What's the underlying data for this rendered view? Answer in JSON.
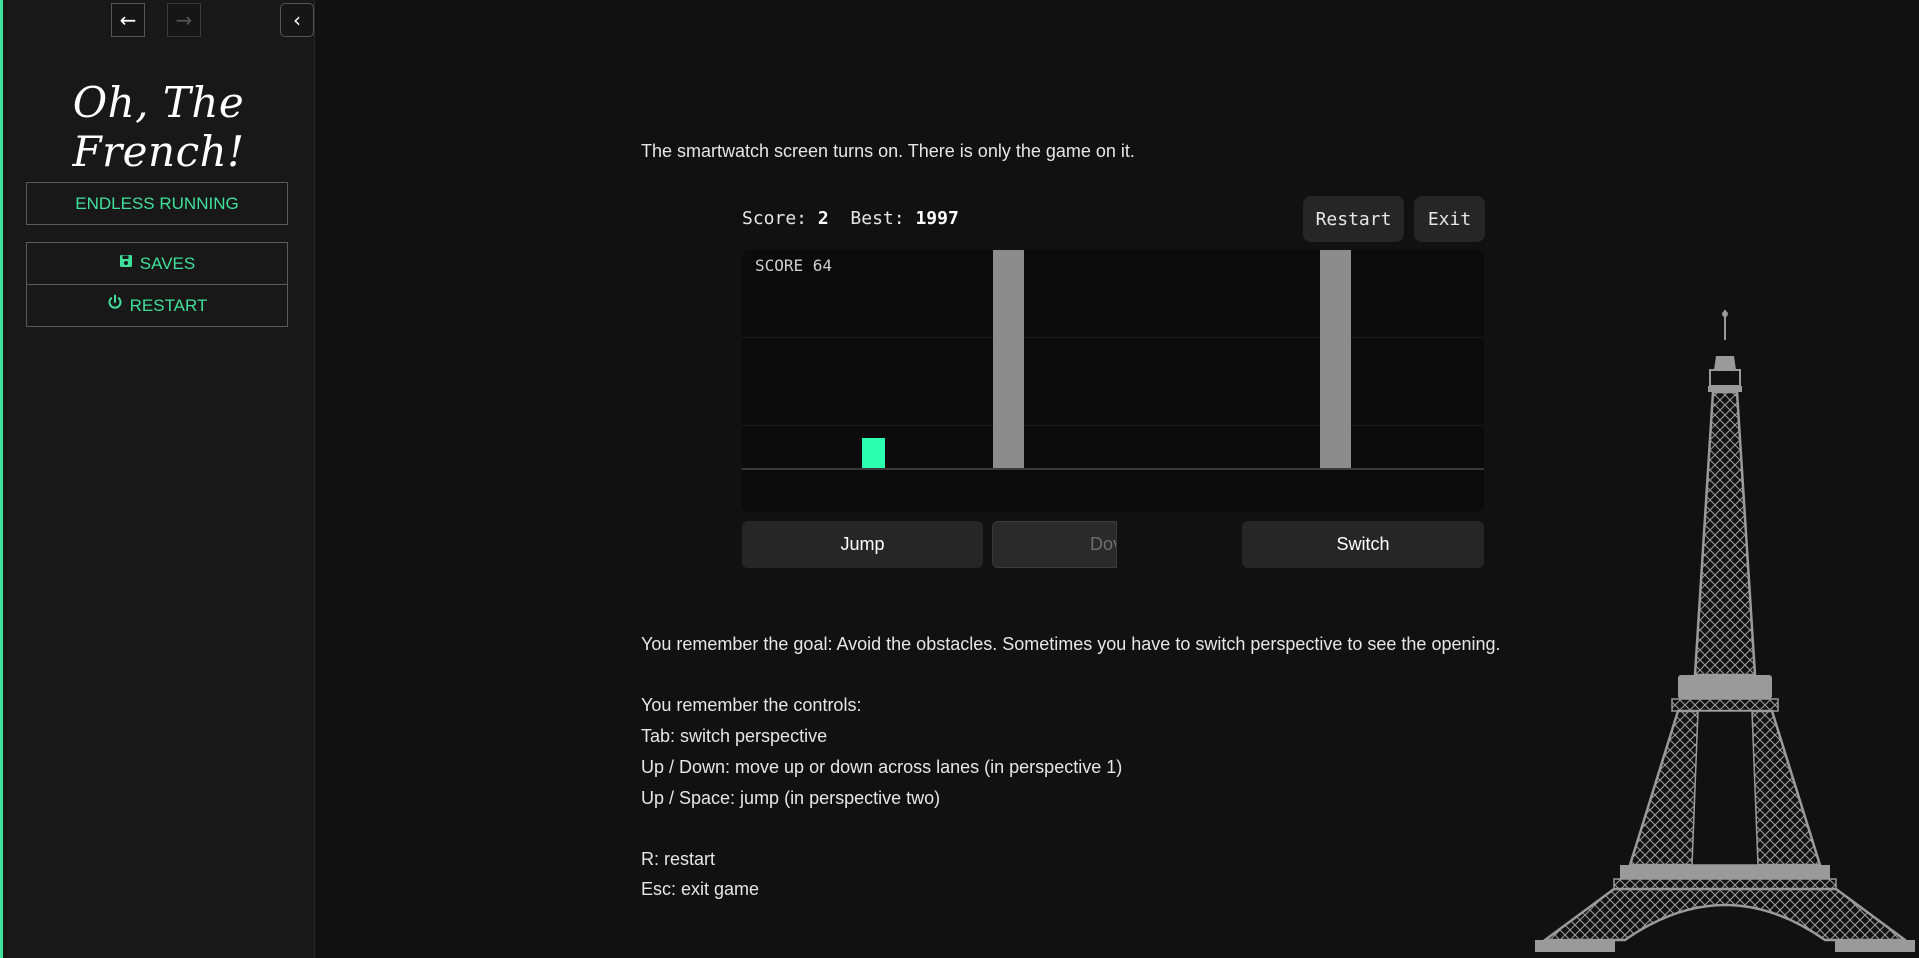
{
  "sidebar": {
    "back_icon": "arrow-left-icon",
    "forward_icon": "arrow-right-icon",
    "collapse_icon": "chevron-left-icon",
    "title": "Oh, The French!",
    "chapter": "ENDLESS RUNNING",
    "menu": [
      {
        "label": "SAVES",
        "icon": "floppy-disk-icon"
      },
      {
        "label": "RESTART",
        "icon": "power-icon"
      }
    ],
    "accent_color": "#3fe09a"
  },
  "main": {
    "intro": "The smartwatch screen turns on. There is only the game on it.",
    "goal": "You remember the goal: Avoid the obstacles. Sometimes you have to switch perspective to see the opening.",
    "controls_heading": "You remember the controls:",
    "controls": [
      "Tab: switch perspective",
      "Up / Down: move up or down across lanes (in perspective 1)",
      "Up / Space: jump (in perspective two)"
    ],
    "extra_controls": [
      "R: restart",
      "Esc: exit game"
    ]
  },
  "game": {
    "score_label": "Score:",
    "score": "2",
    "best_label": "Best:",
    "best": "1997",
    "restart_label": "Restart",
    "exit_label": "Exit",
    "canvas_score": "SCORE 64",
    "jump_label": "Jump",
    "down_label": "Dov",
    "switch_label": "Switch",
    "player_color": "#2bffb0",
    "obstacle_color": "#8c8c8c"
  }
}
